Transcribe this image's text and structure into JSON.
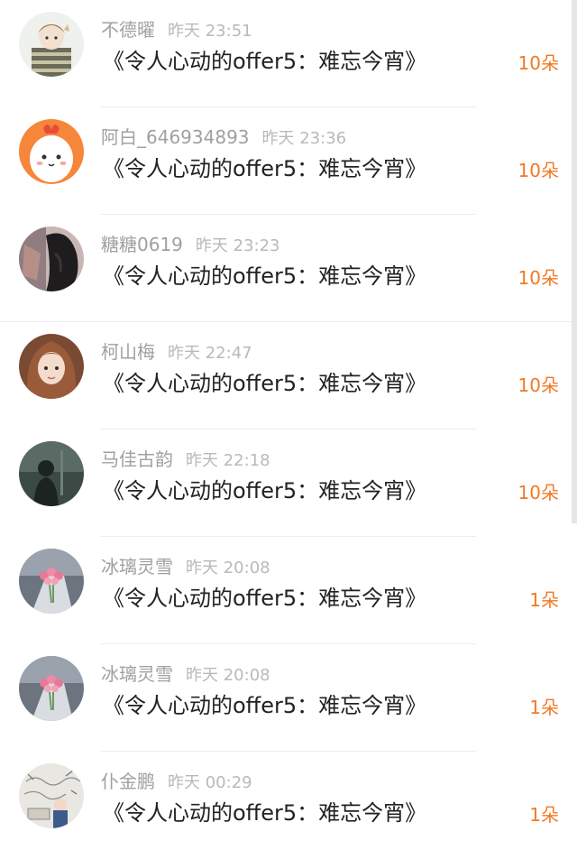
{
  "colors": {
    "name": "#a0a0a0",
    "time": "#b9b9b9",
    "title": "#222222",
    "gift": "#f07a24",
    "divider": "#ececec"
  },
  "items": [
    {
      "user": "不德曜",
      "time": "昨天 23:51",
      "title": "《令人心动的offer5：难忘今宵》",
      "gift": "10朵",
      "avatar_icon": "striped-shirt-cartoon-avatar"
    },
    {
      "user": "阿白_646934893",
      "time": "昨天 23:36",
      "title": "《令人心动的offer5：难忘今宵》",
      "gift": "10朵",
      "avatar_icon": "orange-cartoon-avatar"
    },
    {
      "user": "糖糖0619",
      "time": "昨天 23:23",
      "title": "《令人心动的offer5：难忘今宵》",
      "gift": "10朵",
      "avatar_icon": "dark-hair-avatar"
    },
    {
      "user": "柯山梅",
      "time": "昨天 22:47",
      "title": "《令人心动的offer5：难忘今宵》",
      "gift": "10朵",
      "avatar_icon": "girl-photo-avatar"
    },
    {
      "user": "马佳古韵",
      "time": "昨天 22:18",
      "title": "《令人心动的offer5：难忘今宵》",
      "gift": "10朵",
      "avatar_icon": "silhouette-avatar"
    },
    {
      "user": "冰璃灵雪",
      "time": "昨天 20:08",
      "title": "《令人心动的offer5：难忘今宵》",
      "gift": "1朵",
      "avatar_icon": "flowers-avatar"
    },
    {
      "user": "冰璃灵雪",
      "time": "昨天 20:08",
      "title": "《令人心动的offer5：难忘今宵》",
      "gift": "1朵",
      "avatar_icon": "flowers-avatar"
    },
    {
      "user": "仆金鹏",
      "time": "昨天 00:29",
      "title": "《令人心动的offer5：难忘今宵》",
      "gift": "1朵",
      "avatar_icon": "sketch-avatar"
    }
  ]
}
